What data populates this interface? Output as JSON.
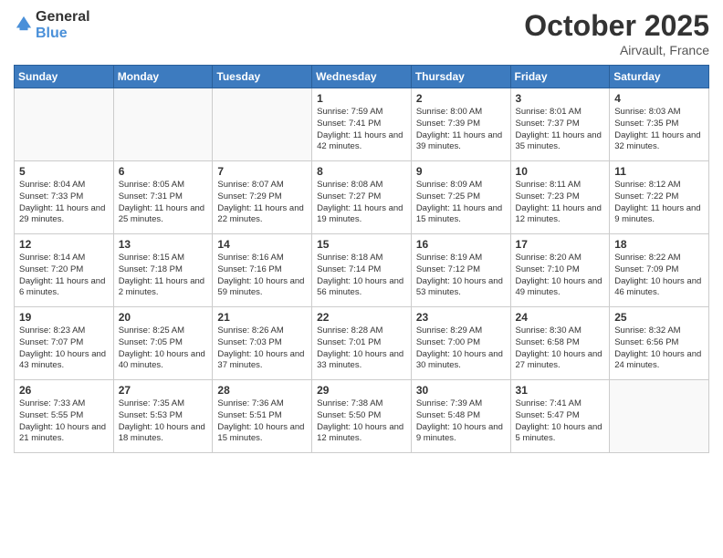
{
  "header": {
    "logo_line1": "General",
    "logo_line2": "Blue",
    "month": "October 2025",
    "location": "Airvault, France"
  },
  "weekdays": [
    "Sunday",
    "Monday",
    "Tuesday",
    "Wednesday",
    "Thursday",
    "Friday",
    "Saturday"
  ],
  "weeks": [
    [
      {
        "day": "",
        "sunrise": "",
        "sunset": "",
        "daylight": ""
      },
      {
        "day": "",
        "sunrise": "",
        "sunset": "",
        "daylight": ""
      },
      {
        "day": "",
        "sunrise": "",
        "sunset": "",
        "daylight": ""
      },
      {
        "day": "1",
        "sunrise": "Sunrise: 7:59 AM",
        "sunset": "Sunset: 7:41 PM",
        "daylight": "Daylight: 11 hours and 42 minutes."
      },
      {
        "day": "2",
        "sunrise": "Sunrise: 8:00 AM",
        "sunset": "Sunset: 7:39 PM",
        "daylight": "Daylight: 11 hours and 39 minutes."
      },
      {
        "day": "3",
        "sunrise": "Sunrise: 8:01 AM",
        "sunset": "Sunset: 7:37 PM",
        "daylight": "Daylight: 11 hours and 35 minutes."
      },
      {
        "day": "4",
        "sunrise": "Sunrise: 8:03 AM",
        "sunset": "Sunset: 7:35 PM",
        "daylight": "Daylight: 11 hours and 32 minutes."
      }
    ],
    [
      {
        "day": "5",
        "sunrise": "Sunrise: 8:04 AM",
        "sunset": "Sunset: 7:33 PM",
        "daylight": "Daylight: 11 hours and 29 minutes."
      },
      {
        "day": "6",
        "sunrise": "Sunrise: 8:05 AM",
        "sunset": "Sunset: 7:31 PM",
        "daylight": "Daylight: 11 hours and 25 minutes."
      },
      {
        "day": "7",
        "sunrise": "Sunrise: 8:07 AM",
        "sunset": "Sunset: 7:29 PM",
        "daylight": "Daylight: 11 hours and 22 minutes."
      },
      {
        "day": "8",
        "sunrise": "Sunrise: 8:08 AM",
        "sunset": "Sunset: 7:27 PM",
        "daylight": "Daylight: 11 hours and 19 minutes."
      },
      {
        "day": "9",
        "sunrise": "Sunrise: 8:09 AM",
        "sunset": "Sunset: 7:25 PM",
        "daylight": "Daylight: 11 hours and 15 minutes."
      },
      {
        "day": "10",
        "sunrise": "Sunrise: 8:11 AM",
        "sunset": "Sunset: 7:23 PM",
        "daylight": "Daylight: 11 hours and 12 minutes."
      },
      {
        "day": "11",
        "sunrise": "Sunrise: 8:12 AM",
        "sunset": "Sunset: 7:22 PM",
        "daylight": "Daylight: 11 hours and 9 minutes."
      }
    ],
    [
      {
        "day": "12",
        "sunrise": "Sunrise: 8:14 AM",
        "sunset": "Sunset: 7:20 PM",
        "daylight": "Daylight: 11 hours and 6 minutes."
      },
      {
        "day": "13",
        "sunrise": "Sunrise: 8:15 AM",
        "sunset": "Sunset: 7:18 PM",
        "daylight": "Daylight: 11 hours and 2 minutes."
      },
      {
        "day": "14",
        "sunrise": "Sunrise: 8:16 AM",
        "sunset": "Sunset: 7:16 PM",
        "daylight": "Daylight: 10 hours and 59 minutes."
      },
      {
        "day": "15",
        "sunrise": "Sunrise: 8:18 AM",
        "sunset": "Sunset: 7:14 PM",
        "daylight": "Daylight: 10 hours and 56 minutes."
      },
      {
        "day": "16",
        "sunrise": "Sunrise: 8:19 AM",
        "sunset": "Sunset: 7:12 PM",
        "daylight": "Daylight: 10 hours and 53 minutes."
      },
      {
        "day": "17",
        "sunrise": "Sunrise: 8:20 AM",
        "sunset": "Sunset: 7:10 PM",
        "daylight": "Daylight: 10 hours and 49 minutes."
      },
      {
        "day": "18",
        "sunrise": "Sunrise: 8:22 AM",
        "sunset": "Sunset: 7:09 PM",
        "daylight": "Daylight: 10 hours and 46 minutes."
      }
    ],
    [
      {
        "day": "19",
        "sunrise": "Sunrise: 8:23 AM",
        "sunset": "Sunset: 7:07 PM",
        "daylight": "Daylight: 10 hours and 43 minutes."
      },
      {
        "day": "20",
        "sunrise": "Sunrise: 8:25 AM",
        "sunset": "Sunset: 7:05 PM",
        "daylight": "Daylight: 10 hours and 40 minutes."
      },
      {
        "day": "21",
        "sunrise": "Sunrise: 8:26 AM",
        "sunset": "Sunset: 7:03 PM",
        "daylight": "Daylight: 10 hours and 37 minutes."
      },
      {
        "day": "22",
        "sunrise": "Sunrise: 8:28 AM",
        "sunset": "Sunset: 7:01 PM",
        "daylight": "Daylight: 10 hours and 33 minutes."
      },
      {
        "day": "23",
        "sunrise": "Sunrise: 8:29 AM",
        "sunset": "Sunset: 7:00 PM",
        "daylight": "Daylight: 10 hours and 30 minutes."
      },
      {
        "day": "24",
        "sunrise": "Sunrise: 8:30 AM",
        "sunset": "Sunset: 6:58 PM",
        "daylight": "Daylight: 10 hours and 27 minutes."
      },
      {
        "day": "25",
        "sunrise": "Sunrise: 8:32 AM",
        "sunset": "Sunset: 6:56 PM",
        "daylight": "Daylight: 10 hours and 24 minutes."
      }
    ],
    [
      {
        "day": "26",
        "sunrise": "Sunrise: 7:33 AM",
        "sunset": "Sunset: 5:55 PM",
        "daylight": "Daylight: 10 hours and 21 minutes."
      },
      {
        "day": "27",
        "sunrise": "Sunrise: 7:35 AM",
        "sunset": "Sunset: 5:53 PM",
        "daylight": "Daylight: 10 hours and 18 minutes."
      },
      {
        "day": "28",
        "sunrise": "Sunrise: 7:36 AM",
        "sunset": "Sunset: 5:51 PM",
        "daylight": "Daylight: 10 hours and 15 minutes."
      },
      {
        "day": "29",
        "sunrise": "Sunrise: 7:38 AM",
        "sunset": "Sunset: 5:50 PM",
        "daylight": "Daylight: 10 hours and 12 minutes."
      },
      {
        "day": "30",
        "sunrise": "Sunrise: 7:39 AM",
        "sunset": "Sunset: 5:48 PM",
        "daylight": "Daylight: 10 hours and 9 minutes."
      },
      {
        "day": "31",
        "sunrise": "Sunrise: 7:41 AM",
        "sunset": "Sunset: 5:47 PM",
        "daylight": "Daylight: 10 hours and 5 minutes."
      },
      {
        "day": "",
        "sunrise": "",
        "sunset": "",
        "daylight": ""
      }
    ]
  ]
}
